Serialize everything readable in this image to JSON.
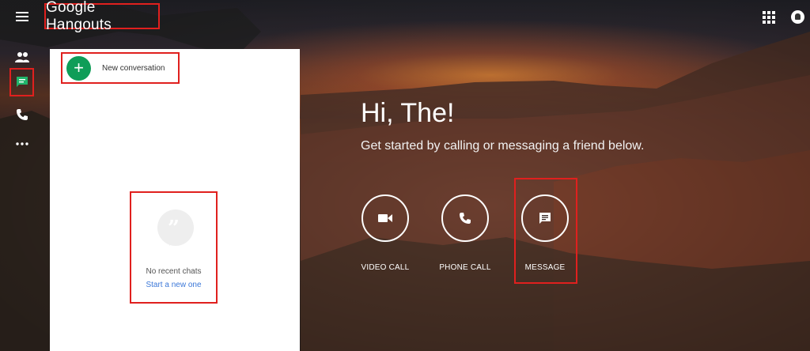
{
  "header": {
    "logo_text": "Google Hangouts"
  },
  "rail": {
    "items": [
      {
        "icon": "people-icon"
      },
      {
        "icon": "chat-icon"
      },
      {
        "icon": "phone-icon"
      },
      {
        "icon": "more-icon"
      }
    ]
  },
  "panel": {
    "new_conversation_label": "New conversation",
    "empty_text": "No recent chats",
    "start_link": "Start a new one"
  },
  "welcome": {
    "greeting": "Hi, The!",
    "subtitle": "Get started by calling or messaging a friend below.",
    "actions": [
      {
        "label": "VIDEO CALL",
        "icon": "video-icon"
      },
      {
        "label": "PHONE CALL",
        "icon": "phone-icon"
      },
      {
        "label": "MESSAGE",
        "icon": "message-icon"
      }
    ]
  },
  "colors": {
    "accent_green": "#0f9d58",
    "link_blue": "#3c78d8",
    "highlight_red": "#e0201e"
  }
}
